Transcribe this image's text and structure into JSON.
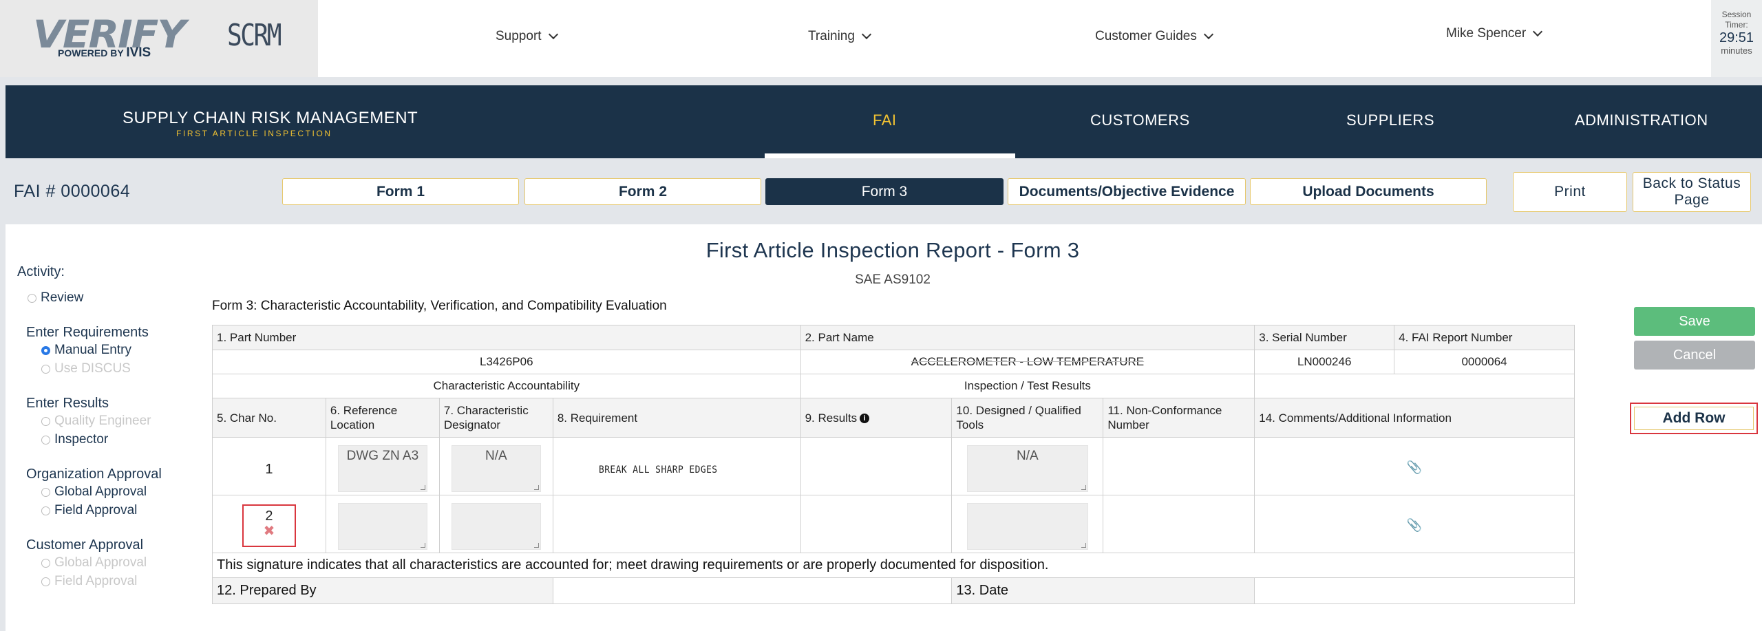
{
  "header": {
    "logo_main": "VERIFY",
    "logo_powered": "POWERED BY",
    "logo_ivis": "IVIS",
    "app_name": "SCRM",
    "nav": [
      {
        "label": "Support"
      },
      {
        "label": "Training"
      },
      {
        "label": "Customer Guides"
      }
    ],
    "user": "Mike Spencer",
    "session_label_1": "Session",
    "session_label_2": "Timer:",
    "session_time": "29:51",
    "session_unit": "minutes"
  },
  "navbar": {
    "brand": "SUPPLY CHAIN RISK MANAGEMENT",
    "brand_sub": "FIRST ARTICLE INSPECTION",
    "links": [
      "FAI",
      "CUSTOMERS",
      "SUPPLIERS",
      "ADMINISTRATION"
    ],
    "active": "FAI"
  },
  "formbar": {
    "fai_number": "FAI # 0000064",
    "tabs": [
      "Form 1",
      "Form 2",
      "Form 3",
      "Documents/Objective Evidence",
      "Upload Documents"
    ],
    "active_tab": "Form 3",
    "print": "Print",
    "back_line1": "Back to Status",
    "back_line2": "Page"
  },
  "report": {
    "title": "First Article Inspection Report - Form 3",
    "subtitle": "SAE AS9102",
    "caption": "Form 3: Characteristic Accountability, Verification, and Compatibility Evaluation"
  },
  "sidebar": {
    "activity": "Activity:",
    "review": "Review",
    "enter_requirements": "Enter Requirements",
    "manual_entry": "Manual Entry",
    "use_discus": "Use DISCUS",
    "enter_results": "Enter Results",
    "quality_engineer": "Quality Engineer",
    "inspector": "Inspector",
    "org_approval": "Organization Approval",
    "global_approval": "Global Approval",
    "field_approval": "Field Approval",
    "customer_approval": "Customer Approval",
    "cust_global_approval": "Global Approval",
    "cust_field_approval": "Field Approval"
  },
  "table": {
    "h_part_number": "1. Part Number",
    "h_part_name": "2. Part Name",
    "h_serial": "3. Serial Number",
    "h_fai_report": "4. FAI Report Number",
    "part_number": "L3426P06",
    "part_name": "ACCELEROMETER - LOW TEMPERATURE",
    "serial": "LN000246",
    "fai_report": "0000064",
    "sec_char": "Characteristic Accountability",
    "sec_insp": "Inspection / Test Results",
    "cols": {
      "char_no": "5. Char No.",
      "ref_loc": "6. Reference Location",
      "char_des": "7. Characteristic Designator",
      "requirement": "8. Requirement",
      "results": "9. Results",
      "tools": "10. Designed / Qualified Tools",
      "ncr": "11. Non-Conformance Number",
      "comments": "14. Comments/Additional Information"
    },
    "rows": [
      {
        "char_no": "1",
        "ref_loc": "DWG ZN A3",
        "char_des": "N/A",
        "requirement": "BREAK ALL SHARP EDGES",
        "tools": "N/A"
      },
      {
        "char_no": "2",
        "delete_icon": "✖"
      }
    ],
    "signature_text": "This signature indicates that all characteristics are accounted for; meet drawing requirements or are properly documented for disposition.",
    "prepared_by": "12. Prepared By",
    "date": "13. Date"
  },
  "actions": {
    "save": "Save",
    "cancel": "Cancel",
    "add_row": "Add Row"
  }
}
